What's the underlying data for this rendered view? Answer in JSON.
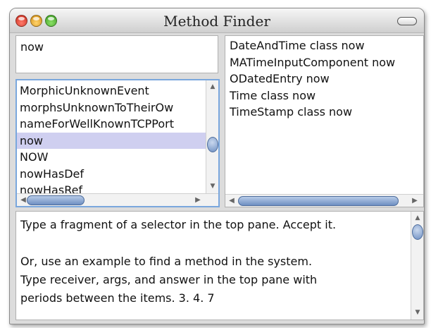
{
  "window": {
    "title": "Method Finder"
  },
  "query": {
    "value": "now"
  },
  "selectors": {
    "items": [
      "MorphicUnknownEvent",
      "morphsUnknownToTheirOw",
      "nameForWellKnownTCPPort",
      "now",
      "NOW",
      "nowHasDef",
      "nowHasRef"
    ],
    "selected_index": 3
  },
  "implementors": {
    "items": [
      "DateAndTime class now",
      "MATimeInputComponent now",
      "ODatedEntry now",
      "Time class now",
      "TimeStamp class now"
    ]
  },
  "help": {
    "lines": [
      "Type a fragment of a selector in the top pane.  Accept it.",
      "",
      "Or, use an example to find a method in the system.",
      "Type receiver, args, and answer in the top pane with",
      "periods between the items.  3. 4. 7"
    ]
  },
  "icons": {
    "close": "close-icon",
    "minimize": "minimize-icon",
    "maximize": "maximize-icon",
    "collapse": "collapse-icon",
    "scroll_up": "chevron-up-icon",
    "scroll_down": "chevron-down-icon",
    "scroll_left": "chevron-left-icon",
    "scroll_right": "chevron-right-icon"
  },
  "colors": {
    "selection": "#cfcff0",
    "focus_border": "#7aa7dd",
    "scroll_thumb": "#6e8fc2"
  }
}
